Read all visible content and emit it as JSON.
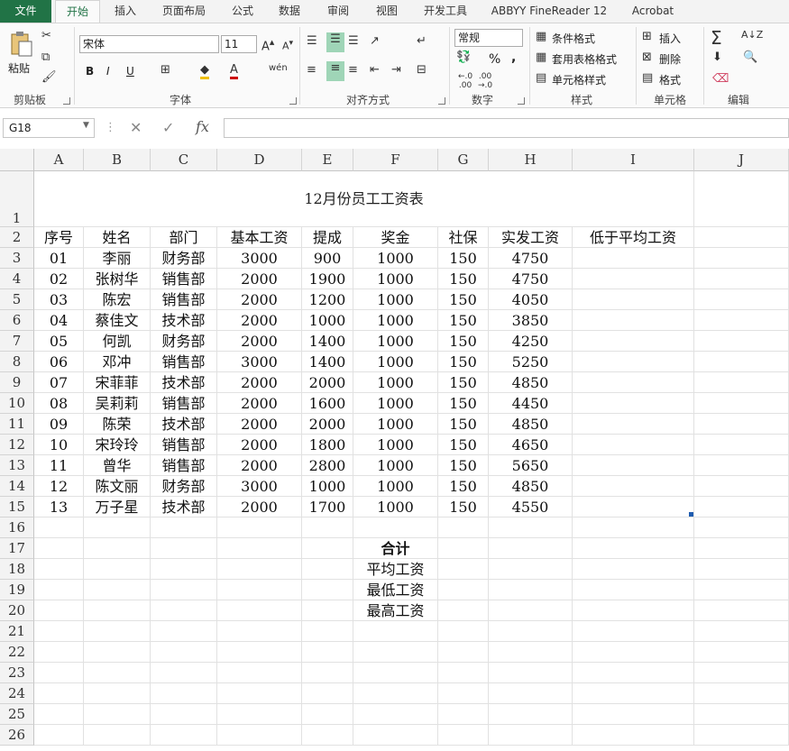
{
  "tabs": [
    "文件",
    "开始",
    "插入",
    "页面布局",
    "公式",
    "数据",
    "审阅",
    "视图",
    "开发工具",
    "ABBYY FineReader 12",
    "Acrobat"
  ],
  "ribbon": {
    "clipboard": {
      "paste": "粘贴",
      "label": "剪贴板"
    },
    "font": {
      "name": "宋体",
      "size": "11",
      "label": "字体",
      "bold": "B",
      "italic": "I",
      "underline": "U"
    },
    "alignment": {
      "label": "对齐方式"
    },
    "number": {
      "format": "常规",
      "percent": "%",
      "comma": ",",
      "label": "数字"
    },
    "styles": {
      "conditional": "条件格式",
      "table": "套用表格格式",
      "cell": "单元格样式",
      "label": "样式"
    },
    "cells": {
      "insert": "插入",
      "delete": "删除",
      "format": "格式",
      "label": "单元格"
    },
    "editing": {
      "label": "编辑"
    }
  },
  "formula_bar": {
    "name_box": "G18",
    "fx": "fx",
    "value": ""
  },
  "columns": [
    "A",
    "B",
    "C",
    "D",
    "E",
    "F",
    "G",
    "H",
    "I",
    "J"
  ],
  "rows": [
    "1",
    "2",
    "3",
    "4",
    "5",
    "6",
    "7",
    "8",
    "9",
    "10",
    "11",
    "12",
    "13",
    "14",
    "15",
    "16",
    "17",
    "18",
    "19",
    "20",
    "21",
    "22",
    "23",
    "24",
    "25",
    "26"
  ],
  "sheet": {
    "title": "12月份员工工资表",
    "headers": [
      "序号",
      "姓名",
      "部门",
      "基本工资",
      "提成",
      "奖金",
      "社保",
      "实发工资",
      "低于平均工资"
    ],
    "data": [
      [
        "01",
        "李丽",
        "财务部",
        "3000",
        "900",
        "1000",
        "150",
        "4750"
      ],
      [
        "02",
        "张树华",
        "销售部",
        "2000",
        "1900",
        "1000",
        "150",
        "4750"
      ],
      [
        "03",
        "陈宏",
        "销售部",
        "2000",
        "1200",
        "1000",
        "150",
        "4050"
      ],
      [
        "04",
        "蔡佳文",
        "技术部",
        "2000",
        "1000",
        "1000",
        "150",
        "3850"
      ],
      [
        "05",
        "何凯",
        "财务部",
        "2000",
        "1400",
        "1000",
        "150",
        "4250"
      ],
      [
        "06",
        "邓冲",
        "销售部",
        "3000",
        "1400",
        "1000",
        "150",
        "5250"
      ],
      [
        "07",
        "宋菲菲",
        "技术部",
        "2000",
        "2000",
        "1000",
        "150",
        "4850"
      ],
      [
        "08",
        "吴莉莉",
        "销售部",
        "2000",
        "1600",
        "1000",
        "150",
        "4450"
      ],
      [
        "09",
        "陈荣",
        "技术部",
        "2000",
        "2000",
        "1000",
        "150",
        "4850"
      ],
      [
        "10",
        "宋玲玲",
        "销售部",
        "2000",
        "1800",
        "1000",
        "150",
        "4650"
      ],
      [
        "11",
        "曾华",
        "销售部",
        "2000",
        "2800",
        "1000",
        "150",
        "5650"
      ],
      [
        "12",
        "陈文丽",
        "财务部",
        "3000",
        "1000",
        "1000",
        "150",
        "4850"
      ],
      [
        "13",
        "万子星",
        "技术部",
        "2000",
        "1700",
        "1000",
        "150",
        "4550"
      ]
    ],
    "summary": {
      "total": "合计",
      "average": "平均工资",
      "min": "最低工资",
      "max": "最高工资"
    }
  },
  "colors": {
    "file_tab": "#217346",
    "active_tab_text": "#217346",
    "selection_handle": "#1f5cb0"
  }
}
